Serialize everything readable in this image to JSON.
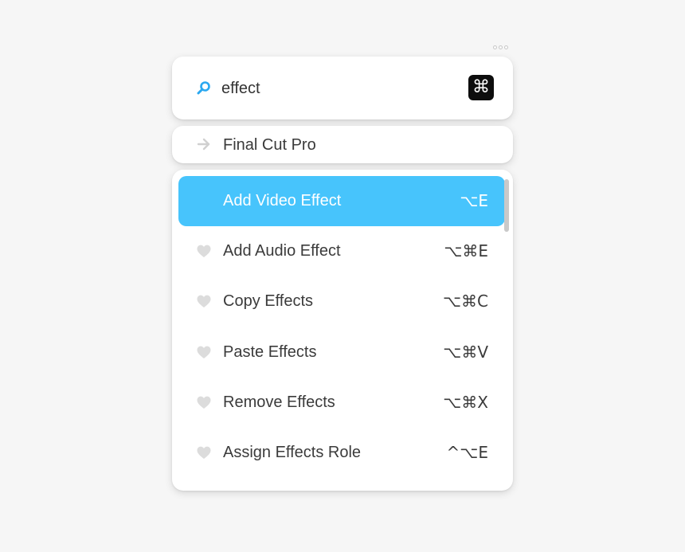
{
  "search": {
    "query": "effect",
    "app_icon_glyph": "⌘"
  },
  "context": {
    "app_name": "Final Cut Pro"
  },
  "commands": [
    {
      "label": "Add Video Effect",
      "shortcut": "⌥E",
      "selected": true
    },
    {
      "label": "Add Audio Effect",
      "shortcut": "⌥⌘E",
      "selected": false
    },
    {
      "label": "Copy Effects",
      "shortcut": "⌥⌘C",
      "selected": false
    },
    {
      "label": "Paste Effects",
      "shortcut": "⌥⌘V",
      "selected": false
    },
    {
      "label": "Remove Effects",
      "shortcut": "⌥⌘X",
      "selected": false
    },
    {
      "label": "Assign Effects Role",
      "shortcut": "^⌥E",
      "selected": false
    }
  ],
  "icons": {
    "search": "search-icon",
    "arrow": "arrow-right-icon",
    "favorite": "heart-icon",
    "app": "command-key-icon"
  },
  "colors": {
    "accent": "#47c4fc",
    "search_icon": "#2aa8f0",
    "heart": "#d9d9d9",
    "background": "#f6f6f6"
  }
}
